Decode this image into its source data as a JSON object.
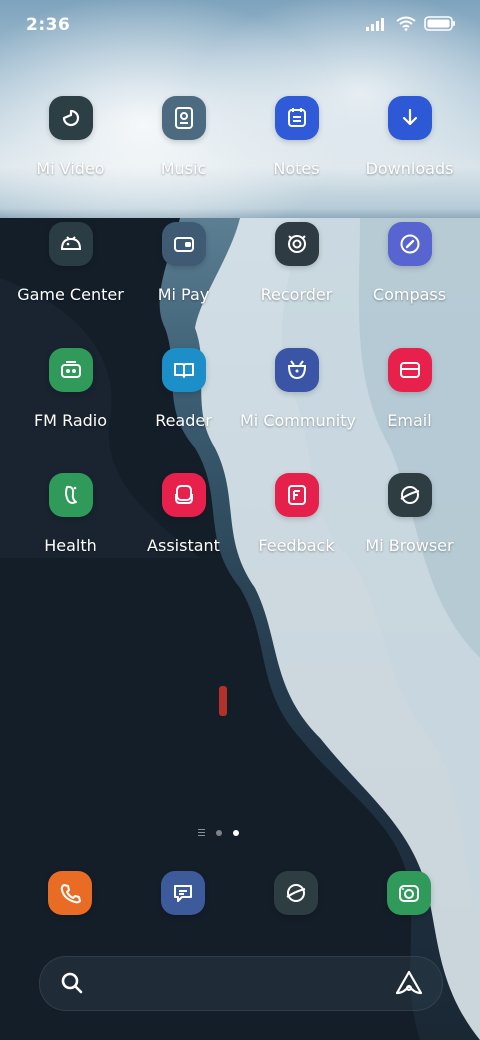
{
  "status_bar": {
    "time": "2:36",
    "icons": [
      "signal-icon",
      "wifi-icon",
      "battery-icon"
    ]
  },
  "apps": [
    {
      "label": "Mi Video",
      "icon": "mi-video-icon",
      "color": "#2c3f45"
    },
    {
      "label": "Music",
      "icon": "music-icon",
      "color": "#4c6b80"
    },
    {
      "label": "Notes",
      "icon": "notes-icon",
      "color": "#2f5bd8"
    },
    {
      "label": "Downloads",
      "icon": "download-icon",
      "color": "#2d58d6"
    },
    {
      "label": "Game Center",
      "icon": "game-center-icon",
      "color": "#2b3d44"
    },
    {
      "label": "Mi Pay",
      "icon": "wallet-icon",
      "color": "#3f5a73"
    },
    {
      "label": "Recorder",
      "icon": "recorder-icon",
      "color": "#2e3b43"
    },
    {
      "label": "Compass",
      "icon": "compass-icon",
      "color": "#5864cf"
    },
    {
      "label": "FM Radio",
      "icon": "radio-icon",
      "color": "#2f9a5a"
    },
    {
      "label": "Reader",
      "icon": "reader-icon",
      "color": "#1c8ec8"
    },
    {
      "label": "Mi Community",
      "icon": "community-icon",
      "color": "#3a55a6"
    },
    {
      "label": "Email",
      "icon": "email-icon",
      "color": "#e8214c"
    },
    {
      "label": "Health",
      "icon": "health-icon",
      "color": "#2f9a5a"
    },
    {
      "label": "Assistant",
      "icon": "assistant-icon",
      "color": "#e8214c"
    },
    {
      "label": "Feedback",
      "icon": "feedback-icon",
      "color": "#e5214b"
    },
    {
      "label": "Mi Browser",
      "icon": "browser-icon",
      "color": "#2e3d42"
    }
  ],
  "dock": [
    {
      "icon": "phone-icon",
      "color": "#e86c24"
    },
    {
      "icon": "messages-icon",
      "color": "#3d5a9b"
    },
    {
      "icon": "browser-icon",
      "color": "#2e3d42"
    },
    {
      "icon": "camera-icon",
      "color": "#2f9a5a"
    }
  ],
  "page_indicator": {
    "pages": 2,
    "current": 2
  },
  "search_bar": {
    "icon": "search-icon",
    "assistant_icon": "ai-assistant-icon"
  }
}
